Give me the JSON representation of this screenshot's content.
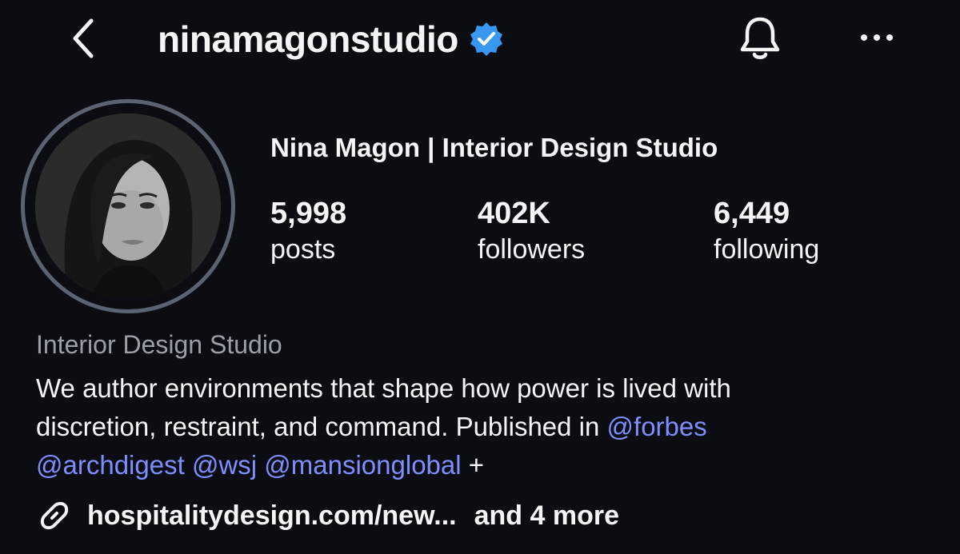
{
  "header": {
    "username": "ninamagonstudio",
    "back_icon": "chevron-left-icon",
    "verified_icon": "verified-badge-icon",
    "bell_icon": "bell-icon",
    "more_icon": "more-horizontal-icon"
  },
  "profile": {
    "display_name": "Nina Magon | Interior Design Studio",
    "stats": [
      {
        "value": "5,998",
        "label": "posts"
      },
      {
        "value": "402K",
        "label": "followers"
      },
      {
        "value": "6,449",
        "label": "following"
      }
    ]
  },
  "bio": {
    "category": "Interior Design Studio",
    "line1": "We author environments that shape how power is lived with",
    "line2_text": "discretion, restraint, and command. Published in ",
    "mention_forbes": "@forbes",
    "mention_archdigest": "@archdigest",
    "mention_wsj": "@wsj",
    "mention_mansionglobal": "@mansionglobal",
    "plus": "+"
  },
  "links": {
    "icon": "link-chain-icon",
    "primary": "hospitalitydesign.com/new...",
    "more": "and 4 more"
  },
  "colors": {
    "background": "#0b0d12",
    "text": "#f5f5f7",
    "secondary_text": "#9aa0a8",
    "mention": "#7f8eff",
    "verified": "#3897f0",
    "avatar_ring": "#5b6270"
  }
}
